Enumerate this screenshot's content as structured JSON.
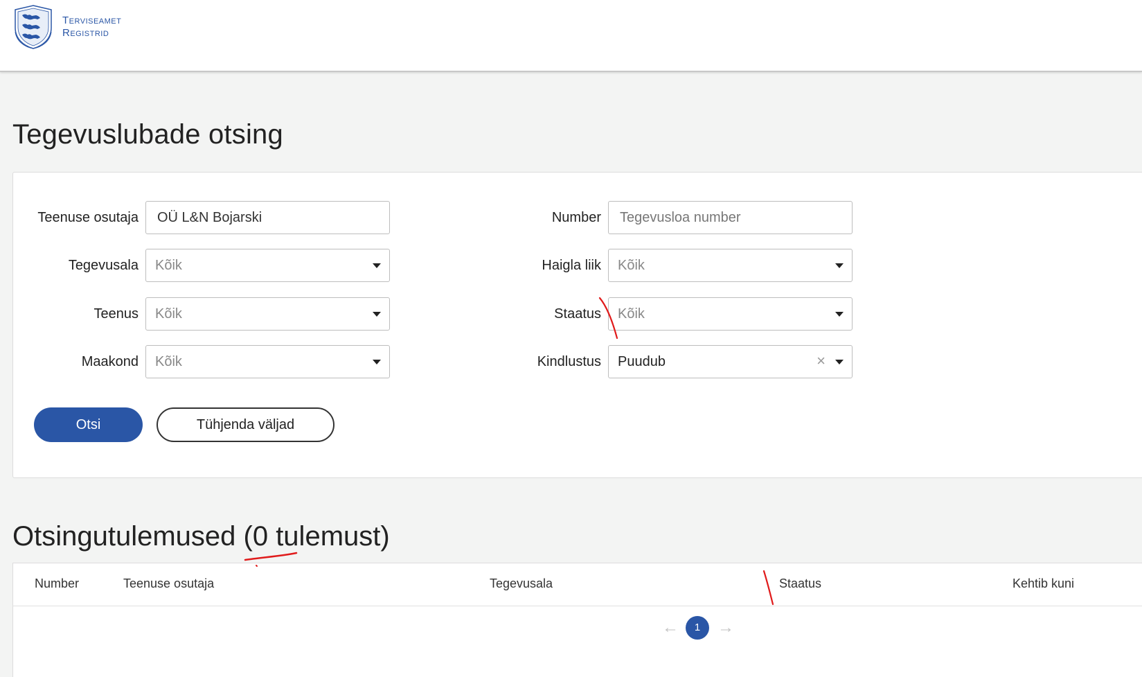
{
  "header": {
    "brand_line1": "Terviseamet",
    "brand_line2": "Registrid",
    "crest_icon": "estonian-coat-of-arms-icon"
  },
  "page_title": "Tegevuslubade otsing",
  "search": {
    "provider": {
      "label": "Teenuse osutaja",
      "value": "OÜ L&N Bojarski"
    },
    "number": {
      "label": "Number",
      "placeholder": "Tegevusloa number"
    },
    "activity": {
      "label": "Tegevusala",
      "value": "Kõik"
    },
    "hospital_type": {
      "label": "Haigla liik",
      "value": "Kõik"
    },
    "service": {
      "label": "Teenus",
      "value": "Kõik"
    },
    "status": {
      "label": "Staatus",
      "value": "Kõik"
    },
    "county": {
      "label": "Maakond",
      "value": "Kõik"
    },
    "insurance": {
      "label": "Kindlustus",
      "value": "Puudub",
      "clear_icon": "×"
    },
    "search_button": "Otsi",
    "clear_button": "Tühjenda väljad"
  },
  "results": {
    "title": "Otsingutulemused (0 tulemust)",
    "columns": [
      "Number",
      "Teenuse osutaja",
      "Tegevusala",
      "Staatus",
      "Kehtib kuni"
    ],
    "pager": {
      "prev": "←",
      "current": "1",
      "next": "→"
    }
  },
  "colors": {
    "accent": "#2a56a6",
    "annotation": "#e01b1b"
  }
}
